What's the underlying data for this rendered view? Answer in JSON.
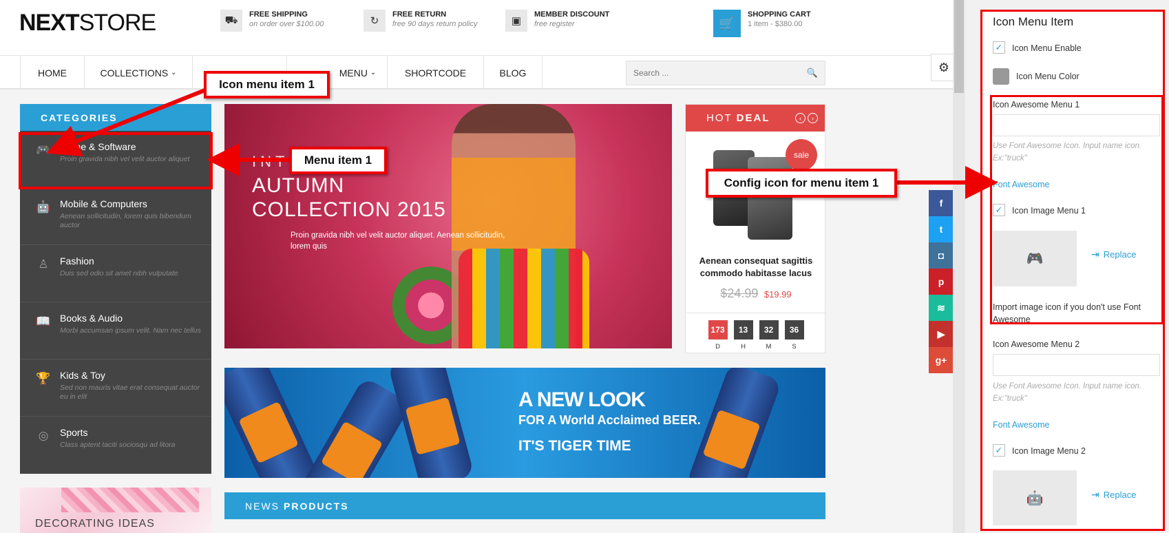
{
  "store": {
    "logo": {
      "part1": "NEXT",
      "part2": "STORE"
    },
    "features": [
      {
        "icon": "truck-icon",
        "title": "FREE SHIPPING",
        "subtitle": "on order over $100.00"
      },
      {
        "icon": "refresh-icon",
        "title": "FREE RETURN",
        "subtitle": "free 90 days return policy"
      },
      {
        "icon": "money-icon",
        "title": "MEMBER DISCOUNT",
        "subtitle": "free register"
      }
    ],
    "cart": {
      "title": "SHOPPING CART",
      "summary": "1 item - $380.00"
    },
    "nav": [
      "HOME",
      "COLLECTIONS",
      "MENU",
      "SHORTCODE",
      "BLOG"
    ],
    "search_placeholder": "Search ...",
    "categories_title": "CATEGORIES",
    "categories": [
      {
        "icon": "gamepad-icon",
        "title": "Game & Software",
        "desc": "Proin gravida nibh vel velit auctor aliquet"
      },
      {
        "icon": "android-icon",
        "title": "Mobile & Computers",
        "desc": "Aenean sollicitudin, lorem quis bibendum auctor"
      },
      {
        "icon": "person-icon",
        "title": "Fashion",
        "desc": "Duis sed odio sit amet nibh vulputate"
      },
      {
        "icon": "book-icon",
        "title": "Books & Audio",
        "desc": "Morbi accumsan ipsum velit. Nam nec tellus"
      },
      {
        "icon": "trophy-icon",
        "title": "Kids & Toy",
        "desc": "Sed non mauris vitae erat consequat auctor eu in elit"
      },
      {
        "icon": "basketball-icon",
        "title": "Sports",
        "desc": "Class aptent taciti sociosqu ad litora"
      }
    ],
    "deco_banner": "DECORATING IDEAS",
    "hero": {
      "title_top": "INT",
      "title": "AUTUMN COLLECTION 2015",
      "text": "Proin gravida nibh vel velit auctor aliquet. Aenean sollicitudin, lorem quis"
    },
    "hot_deal": {
      "title_light": "HOT",
      "title_bold": "DEAL",
      "sale_badge": "sale",
      "product_name": "Aenean consequat sagittis commodo habitasse lacus",
      "old_price": "$24.99",
      "new_price": "$19.99",
      "countdown": [
        {
          "value": "173",
          "label": "D"
        },
        {
          "value": "13",
          "label": "H"
        },
        {
          "value": "32",
          "label": "M"
        },
        {
          "value": "36",
          "label": "S"
        }
      ]
    },
    "social": [
      {
        "name": "facebook-icon",
        "glyph": "f",
        "color": "#3b5998"
      },
      {
        "name": "twitter-icon",
        "glyph": "t",
        "color": "#1da1f2"
      },
      {
        "name": "instagram-icon",
        "glyph": "◘",
        "color": "#3f729b"
      },
      {
        "name": "pinterest-icon",
        "glyph": "p",
        "color": "#cb2027"
      },
      {
        "name": "rss-icon",
        "glyph": "≋",
        "color": "#1abc9c"
      },
      {
        "name": "youtube-icon",
        "glyph": "▶",
        "color": "#c4302b"
      },
      {
        "name": "google-plus-icon",
        "glyph": "g+",
        "color": "#dd4b39"
      }
    ],
    "beer_banner": {
      "line1": "A NEW LOOK",
      "line2": "FOR A World Acclaimed BEER.",
      "line3": "IT'S TIGER TIME"
    },
    "news": {
      "light": "NEWS",
      "bold": "PRODUCTS"
    }
  },
  "panel": {
    "title": "Icon Menu Item",
    "icon_menu_enable": "Icon Menu Enable",
    "icon_menu_color": "Icon Menu Color",
    "menu1": {
      "awesome_label": "Icon Awesome Menu 1",
      "awesome_value": "",
      "hint": "Use Font Awesome Icon. Input name icon. Ex:\"truck\"",
      "link": "Font Awesome",
      "image_label": "Icon Image Menu 1",
      "replace": "Replace",
      "import_note": "Import image icon if you don't use Font Awesome"
    },
    "menu2": {
      "awesome_label": "Icon Awesome Menu 2",
      "awesome_value": "",
      "hint": "Use Font Awesome Icon. Input name icon. Ex:\"truck\"",
      "link": "Font Awesome",
      "image_label": "Icon Image Menu 2",
      "replace": "Replace"
    }
  },
  "callouts": {
    "icon_menu": "Icon menu item 1",
    "menu_item": "Menu item 1",
    "config": "Config icon for menu item 1"
  },
  "colors": {
    "accent": "#2a9fd6",
    "deal": "#e04848",
    "annotation": "#ee0000",
    "sidebar": "#444444"
  }
}
